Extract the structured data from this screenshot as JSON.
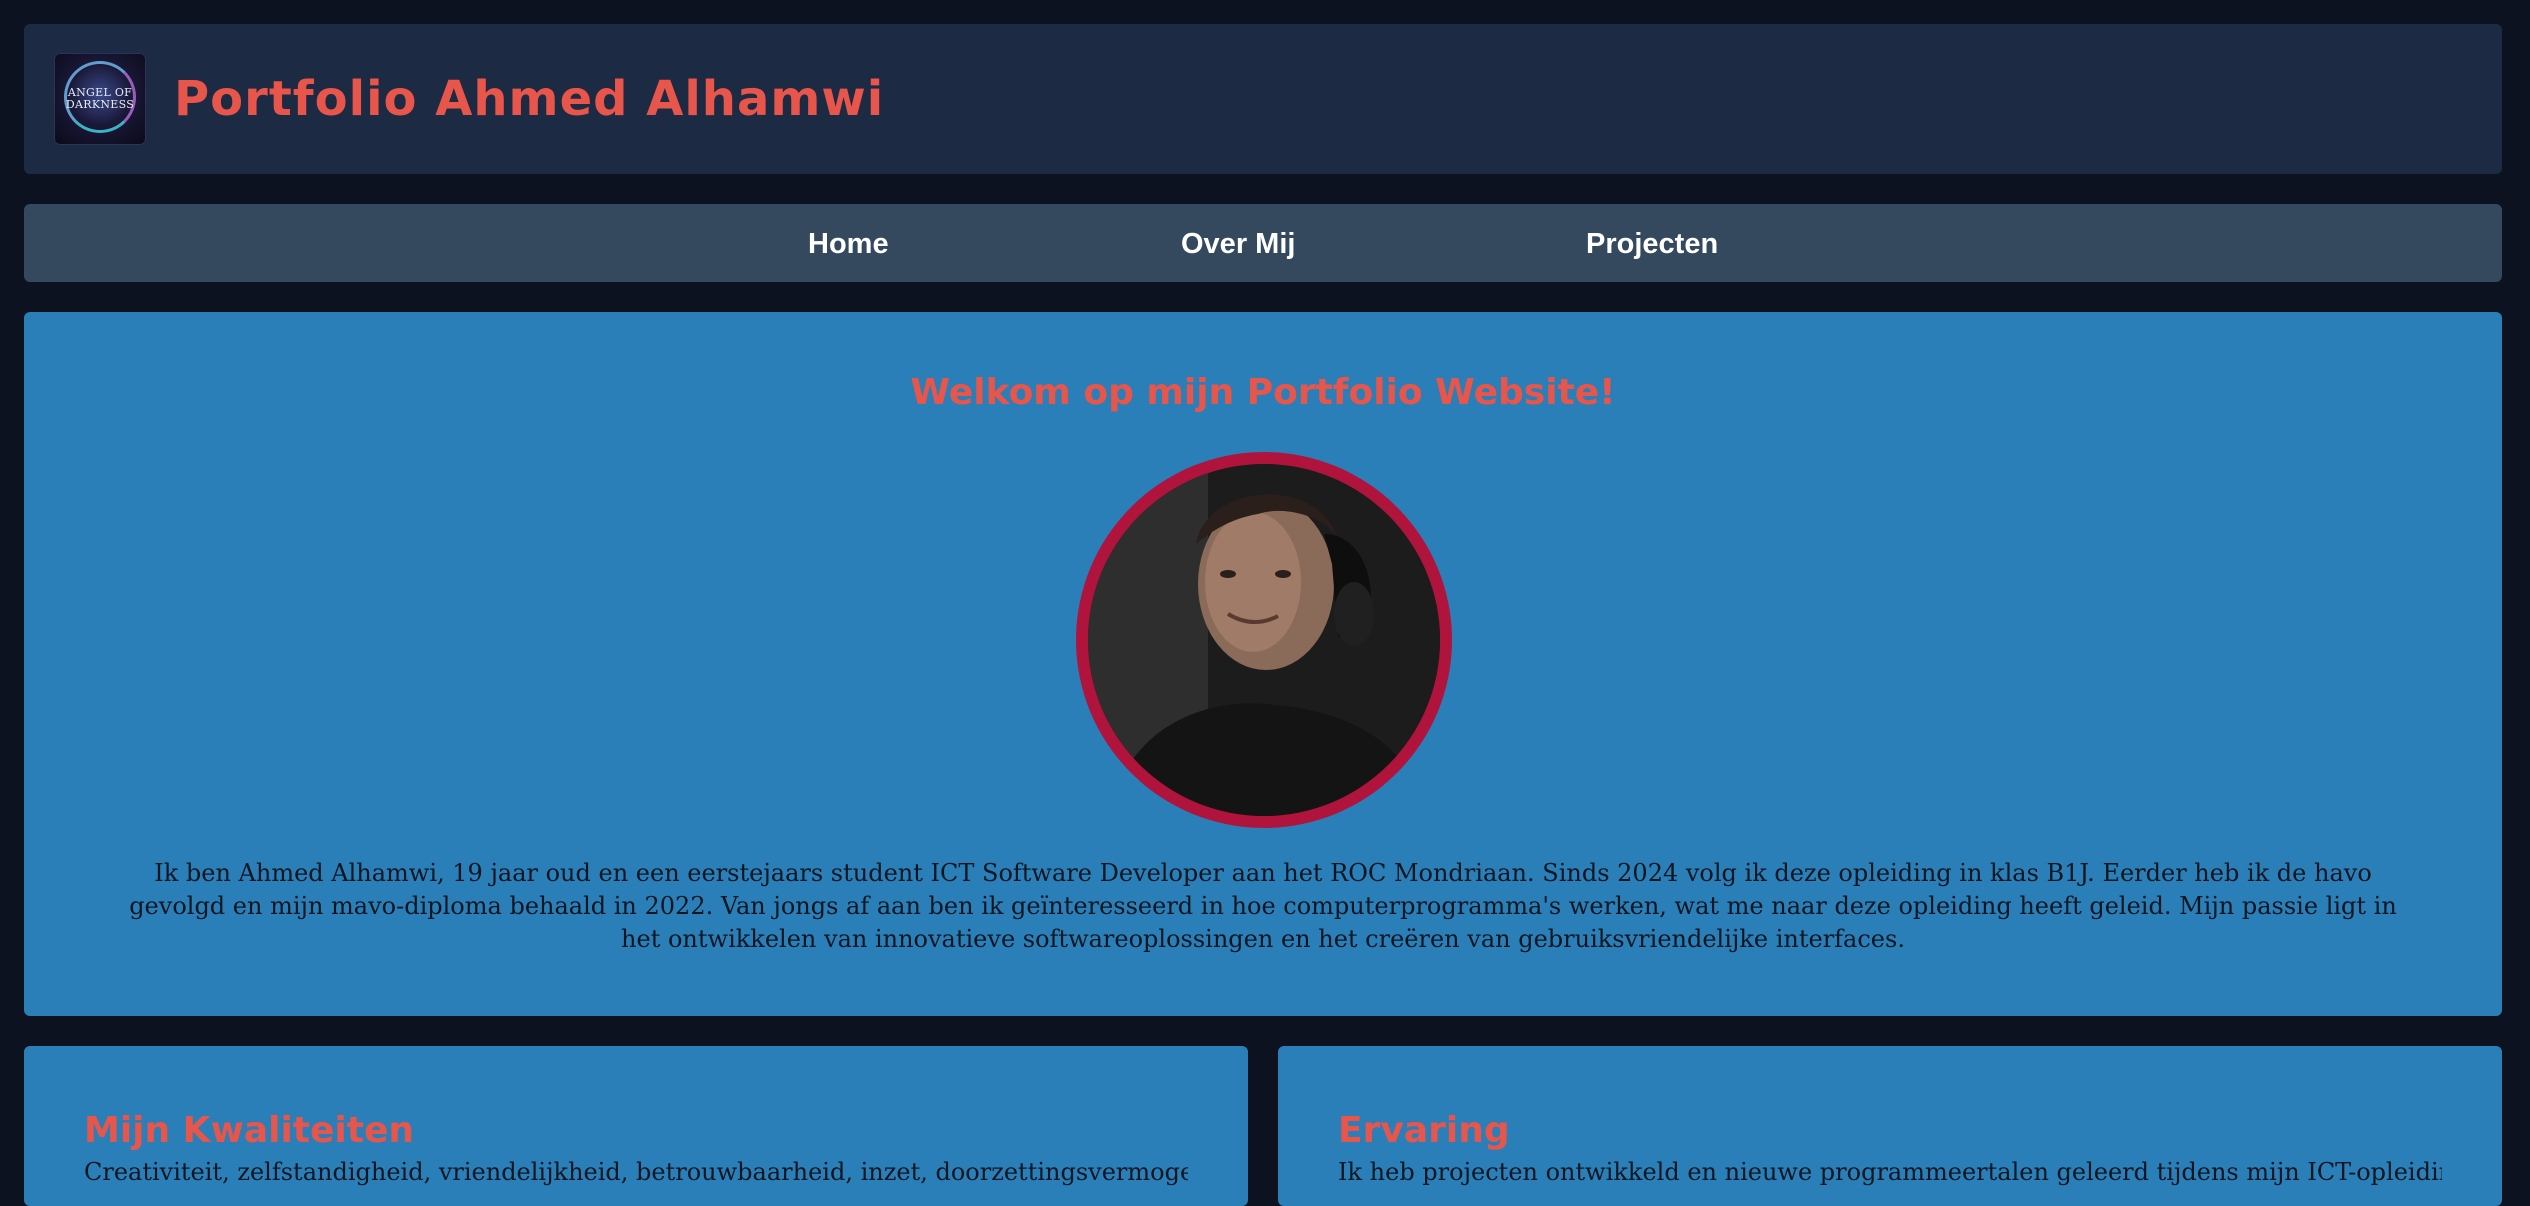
{
  "header": {
    "logo_text": "ANGEL OF DARKNESS",
    "title": "Portfolio Ahmed Alhamwi"
  },
  "nav": {
    "items": [
      {
        "label": "Home"
      },
      {
        "label": "Over Mij"
      },
      {
        "label": "Projecten"
      }
    ]
  },
  "hero": {
    "heading": "Welkom op mijn Portfolio Website!",
    "portrait_alt": "Ahmed Alhamwi",
    "intro": "Ik ben Ahmed Alhamwi, 19 jaar oud en een eerstejaars student ICT Software Developer aan het ROC Mondriaan. Sinds 2024 volg ik deze opleiding in klas B1J. Eerder heb ik de havo gevolgd en mijn mavo-diploma behaald in 2022. Van jongs af aan ben ik geïnteresseerd in hoe computerprogramma's werken, wat me naar deze opleiding heeft geleid. Mijn passie ligt in het ontwikkelen van innovatieve softwareoplossingen en het creëren van gebruiksvriendelijke interfaces."
  },
  "cards": {
    "qualities": {
      "heading": "Mijn Kwaliteiten",
      "text": "Creativiteit, zelfstandigheid, vriendelijkheid, betrouwbaarheid, inzet, doorzettingsvermogen, niet"
    },
    "experience": {
      "heading": "Ervaring",
      "text": "Ik heb projecten ontwikkeld en nieuwe programmeertalen geleerd tijdens mijn ICT-opleiding. Op"
    }
  },
  "colors": {
    "page_bg": "#0c1220",
    "header_bg": "#1c2a44",
    "nav_bg": "#34495e",
    "panel_bg": "#2a7fb9",
    "accent": "#e8554a",
    "portrait_border": "#b0143c"
  }
}
